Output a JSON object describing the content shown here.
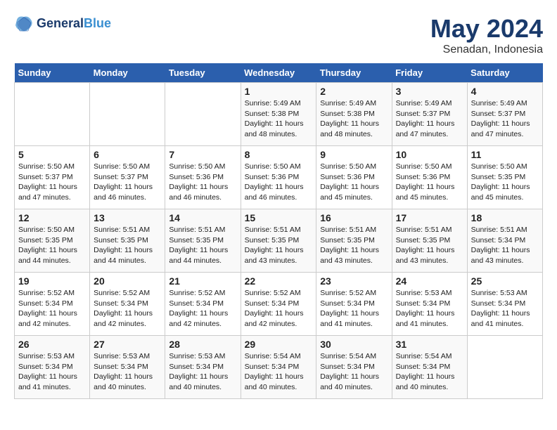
{
  "header": {
    "logo_line1": "General",
    "logo_line2": "Blue",
    "month": "May 2024",
    "location": "Senadan, Indonesia"
  },
  "weekdays": [
    "Sunday",
    "Monday",
    "Tuesday",
    "Wednesday",
    "Thursday",
    "Friday",
    "Saturday"
  ],
  "weeks": [
    [
      {
        "day": "",
        "info": ""
      },
      {
        "day": "",
        "info": ""
      },
      {
        "day": "",
        "info": ""
      },
      {
        "day": "1",
        "info": "Sunrise: 5:49 AM\nSunset: 5:38 PM\nDaylight: 11 hours\nand 48 minutes."
      },
      {
        "day": "2",
        "info": "Sunrise: 5:49 AM\nSunset: 5:38 PM\nDaylight: 11 hours\nand 48 minutes."
      },
      {
        "day": "3",
        "info": "Sunrise: 5:49 AM\nSunset: 5:37 PM\nDaylight: 11 hours\nand 47 minutes."
      },
      {
        "day": "4",
        "info": "Sunrise: 5:49 AM\nSunset: 5:37 PM\nDaylight: 11 hours\nand 47 minutes."
      }
    ],
    [
      {
        "day": "5",
        "info": "Sunrise: 5:50 AM\nSunset: 5:37 PM\nDaylight: 11 hours\nand 47 minutes."
      },
      {
        "day": "6",
        "info": "Sunrise: 5:50 AM\nSunset: 5:37 PM\nDaylight: 11 hours\nand 46 minutes."
      },
      {
        "day": "7",
        "info": "Sunrise: 5:50 AM\nSunset: 5:36 PM\nDaylight: 11 hours\nand 46 minutes."
      },
      {
        "day": "8",
        "info": "Sunrise: 5:50 AM\nSunset: 5:36 PM\nDaylight: 11 hours\nand 46 minutes."
      },
      {
        "day": "9",
        "info": "Sunrise: 5:50 AM\nSunset: 5:36 PM\nDaylight: 11 hours\nand 45 minutes."
      },
      {
        "day": "10",
        "info": "Sunrise: 5:50 AM\nSunset: 5:36 PM\nDaylight: 11 hours\nand 45 minutes."
      },
      {
        "day": "11",
        "info": "Sunrise: 5:50 AM\nSunset: 5:35 PM\nDaylight: 11 hours\nand 45 minutes."
      }
    ],
    [
      {
        "day": "12",
        "info": "Sunrise: 5:50 AM\nSunset: 5:35 PM\nDaylight: 11 hours\nand 44 minutes."
      },
      {
        "day": "13",
        "info": "Sunrise: 5:51 AM\nSunset: 5:35 PM\nDaylight: 11 hours\nand 44 minutes."
      },
      {
        "day": "14",
        "info": "Sunrise: 5:51 AM\nSunset: 5:35 PM\nDaylight: 11 hours\nand 44 minutes."
      },
      {
        "day": "15",
        "info": "Sunrise: 5:51 AM\nSunset: 5:35 PM\nDaylight: 11 hours\nand 43 minutes."
      },
      {
        "day": "16",
        "info": "Sunrise: 5:51 AM\nSunset: 5:35 PM\nDaylight: 11 hours\nand 43 minutes."
      },
      {
        "day": "17",
        "info": "Sunrise: 5:51 AM\nSunset: 5:35 PM\nDaylight: 11 hours\nand 43 minutes."
      },
      {
        "day": "18",
        "info": "Sunrise: 5:51 AM\nSunset: 5:34 PM\nDaylight: 11 hours\nand 43 minutes."
      }
    ],
    [
      {
        "day": "19",
        "info": "Sunrise: 5:52 AM\nSunset: 5:34 PM\nDaylight: 11 hours\nand 42 minutes."
      },
      {
        "day": "20",
        "info": "Sunrise: 5:52 AM\nSunset: 5:34 PM\nDaylight: 11 hours\nand 42 minutes."
      },
      {
        "day": "21",
        "info": "Sunrise: 5:52 AM\nSunset: 5:34 PM\nDaylight: 11 hours\nand 42 minutes."
      },
      {
        "day": "22",
        "info": "Sunrise: 5:52 AM\nSunset: 5:34 PM\nDaylight: 11 hours\nand 42 minutes."
      },
      {
        "day": "23",
        "info": "Sunrise: 5:52 AM\nSunset: 5:34 PM\nDaylight: 11 hours\nand 41 minutes."
      },
      {
        "day": "24",
        "info": "Sunrise: 5:53 AM\nSunset: 5:34 PM\nDaylight: 11 hours\nand 41 minutes."
      },
      {
        "day": "25",
        "info": "Sunrise: 5:53 AM\nSunset: 5:34 PM\nDaylight: 11 hours\nand 41 minutes."
      }
    ],
    [
      {
        "day": "26",
        "info": "Sunrise: 5:53 AM\nSunset: 5:34 PM\nDaylight: 11 hours\nand 41 minutes."
      },
      {
        "day": "27",
        "info": "Sunrise: 5:53 AM\nSunset: 5:34 PM\nDaylight: 11 hours\nand 40 minutes."
      },
      {
        "day": "28",
        "info": "Sunrise: 5:53 AM\nSunset: 5:34 PM\nDaylight: 11 hours\nand 40 minutes."
      },
      {
        "day": "29",
        "info": "Sunrise: 5:54 AM\nSunset: 5:34 PM\nDaylight: 11 hours\nand 40 minutes."
      },
      {
        "day": "30",
        "info": "Sunrise: 5:54 AM\nSunset: 5:34 PM\nDaylight: 11 hours\nand 40 minutes."
      },
      {
        "day": "31",
        "info": "Sunrise: 5:54 AM\nSunset: 5:34 PM\nDaylight: 11 hours\nand 40 minutes."
      },
      {
        "day": "",
        "info": ""
      }
    ]
  ]
}
